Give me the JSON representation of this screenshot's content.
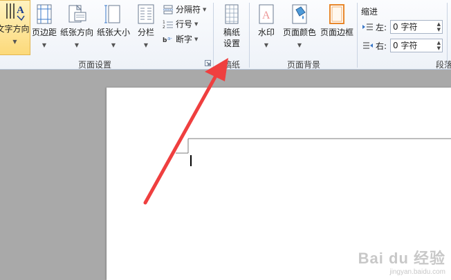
{
  "ribbon": {
    "buttons": {
      "text_direction": "文字方向",
      "margins": "页边距",
      "orientation": "纸张方向",
      "size": "纸张大小",
      "columns": "分栏",
      "breaks": "分隔符",
      "line_numbers": "行号",
      "hyphenation": "断字",
      "manuscript_line1": "稿纸",
      "manuscript_line2": "设置",
      "watermark": "水印",
      "page_color": "页面颜色",
      "page_borders": "页面边框"
    },
    "groups": {
      "page_setup": "页面设置",
      "manuscript": "稿纸",
      "page_background": "页面背景",
      "paragraph": "段落"
    },
    "indent": {
      "title": "缩进",
      "left_label": "左:",
      "left_value": "0 字符",
      "right_label": "右:",
      "right_value": "0 字符"
    }
  },
  "watermark": {
    "line1": "Bai du 经验",
    "line2": "jingyan.baidu.com"
  },
  "colors": {
    "arrow": "#ef3f3f",
    "workspace": "#a9a9a9",
    "highlight": "#fde99a"
  }
}
